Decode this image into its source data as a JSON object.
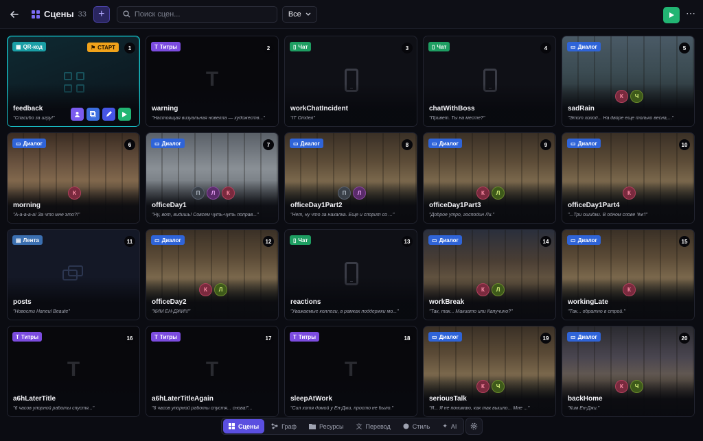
{
  "header": {
    "title": "Сцены",
    "count": "33",
    "search_placeholder": "Поиск сцен...",
    "filter_label": "Все"
  },
  "colors": {
    "accent": "#5b4fe0",
    "selected": "#19c0c8",
    "play": "#22b573"
  },
  "scenes": [
    {
      "num": "1",
      "name": "feedback",
      "desc": "\"Спасибо за игру!\"",
      "tag": "QR-код",
      "start": "СТАРТ",
      "chars": []
    },
    {
      "num": "2",
      "name": "warning",
      "desc": "\"Настоящая визуальная новелла — художеств...\"",
      "tag": "Титры",
      "chars": []
    },
    {
      "num": "3",
      "name": "workChatIncident",
      "desc": "\"IT Отдел\"",
      "tag": "Чат",
      "chars": []
    },
    {
      "num": "4",
      "name": "chatWithBoss",
      "desc": "\"Привет. Ты на месте?\"",
      "tag": "Чат",
      "chars": []
    },
    {
      "num": "5",
      "name": "sadRain",
      "desc": "\"Этот холод... На дворе еще только весна,...\"",
      "tag": "Диалог",
      "chars": [
        "К",
        "Ч"
      ]
    },
    {
      "num": "6",
      "name": "morning",
      "desc": "\"А-а-а-а-а! За что мне это?!\"",
      "tag": "Диалог",
      "chars": [
        "К"
      ]
    },
    {
      "num": "7",
      "name": "officeDay1",
      "desc": "\"Ну, вот, видишь! Совсем чуть-чуть поправ...\"",
      "tag": "Диалог",
      "chars": [
        "П",
        "Л",
        "К"
      ]
    },
    {
      "num": "8",
      "name": "officeDay1Part2",
      "desc": "\"Нет, ну что за нахалка. Еще и спорит со ...\"",
      "tag": "Диалог",
      "chars": [
        "П",
        "Л"
      ]
    },
    {
      "num": "9",
      "name": "officeDay1Part3",
      "desc": "\"Доброе утро, господин Ли.\"",
      "tag": "Диалог",
      "chars": [
        "К",
        "Л"
      ]
    },
    {
      "num": "10",
      "name": "officeDay1Part4",
      "desc": "\"...Три ошибки. В одном слове 'ёж'!\"",
      "tag": "Диалог",
      "chars": [
        "К"
      ]
    },
    {
      "num": "11",
      "name": "posts",
      "desc": "\"Новости Haneul Beaute\"",
      "tag": "Лента",
      "chars": []
    },
    {
      "num": "12",
      "name": "officeDay2",
      "desc": "\"КИМ ЁН-ДЖИ!!!\"",
      "tag": "Диалог",
      "chars": [
        "К",
        "Л"
      ]
    },
    {
      "num": "13",
      "name": "reactions",
      "desc": "\"Уважаемые коллеги, в рамках поддержки мо...\"",
      "tag": "Чат",
      "chars": []
    },
    {
      "num": "14",
      "name": "workBreak",
      "desc": "\"Так, так... Макиато или Капучино?\"",
      "tag": "Диалог",
      "chars": [
        "К",
        "Л"
      ]
    },
    {
      "num": "15",
      "name": "workingLate",
      "desc": "\"Так... обратно в строй.\"",
      "tag": "Диалог",
      "chars": [
        "К"
      ]
    },
    {
      "num": "16",
      "name": "a6hLaterTitle",
      "desc": "\"6 часов упорной работы спустя...\"",
      "tag": "Титры",
      "chars": []
    },
    {
      "num": "17",
      "name": "a6hLaterTitleAgain",
      "desc": "\"6 часов упорной работы спустя... снова!\"...",
      "tag": "Титры",
      "chars": []
    },
    {
      "num": "18",
      "name": "sleepAtWork",
      "desc": "\"Сил хотя домой у Ён-Джи, просто не было.\"",
      "tag": "Титры",
      "chars": []
    },
    {
      "num": "19",
      "name": "seriousTalk",
      "desc": "\"Я... Я не понимаю, как так вышло... Мне ...\"",
      "tag": "Диалог",
      "chars": [
        "К",
        "Ч"
      ]
    },
    {
      "num": "20",
      "name": "backHome",
      "desc": "\"Ким Ён-Джи.\"",
      "tag": "Диалог",
      "chars": [
        "К",
        "Ч"
      ]
    }
  ],
  "card_action_icons": [
    "characters-icon",
    "copy-icon",
    "edit-icon",
    "play-icon"
  ],
  "bottom_nav": [
    "Сцены",
    "Граф",
    "Ресурсы",
    "Перевод",
    "Стиль",
    "AI"
  ]
}
